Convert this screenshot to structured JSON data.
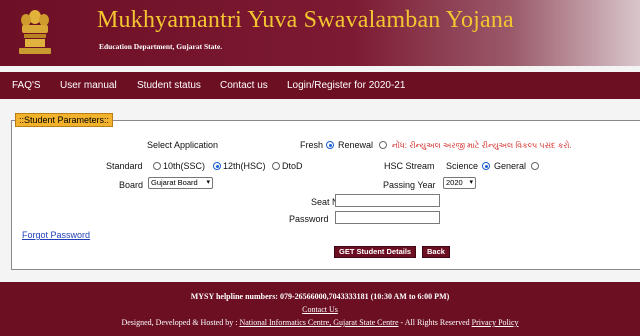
{
  "header": {
    "title": "Mukhyamantri Yuva Swavalamban Yojana",
    "subtitle": "Education Department, Gujarat State."
  },
  "nav": {
    "items": [
      {
        "label": "FAQ'S"
      },
      {
        "label": "User manual"
      },
      {
        "label": "Student status"
      },
      {
        "label": "Contact us"
      },
      {
        "label": "Login/Register for 2020-21"
      }
    ]
  },
  "form": {
    "legend": "::Student Parameters::",
    "select_application_label": "Select Application",
    "fresh_label": "Fresh",
    "fresh_checked": true,
    "renewal_label": "Renewal",
    "renewal_checked": false,
    "notice": "નોંધ: રીન્યુઅલ અરજી માટે રીન્યુઅલ વિકલ્પ પસંદ કરો.",
    "standard_label": "Standard",
    "standard_options": [
      {
        "label": "10th(SSC)",
        "checked": false
      },
      {
        "label": "12th(HSC)",
        "checked": true
      },
      {
        "label": "DtoD",
        "checked": false
      }
    ],
    "hsc_stream_label": "HSC  Stream",
    "stream_options": [
      {
        "label": "Science",
        "checked": true
      },
      {
        "label": "General",
        "checked": false
      }
    ],
    "board_label": "Board",
    "board_value": "Gujarat Board",
    "passing_year_label": "Passing Year",
    "passing_year_value": "2020",
    "seat_no_label": "Seat No",
    "seat_no_value": "",
    "password_label": "Password",
    "password_value": "",
    "forgot_password": "Forgot Password",
    "get_details_button": "GET Student Details",
    "back_button": "Back"
  },
  "footer": {
    "helpline": "MYSY helpline numbers: 079-26566000,7043333181 (10:30 AM to 6:00 PM)",
    "contact_us": "Contact Us",
    "credits_prefix": "Designed, Developed & Hosted by : ",
    "nic": "National Informatics Centre, Gujarat State Centre",
    "rights": " - All Rights Reserved ",
    "privacy": "Privacy Policy"
  },
  "colors": {
    "brand_maroon": "#6c0f23",
    "title_gold": "#f3c531",
    "legend_orange": "#f2b22b",
    "notice_red": "#d2302b",
    "radio_blue": "#1a5fd0"
  }
}
